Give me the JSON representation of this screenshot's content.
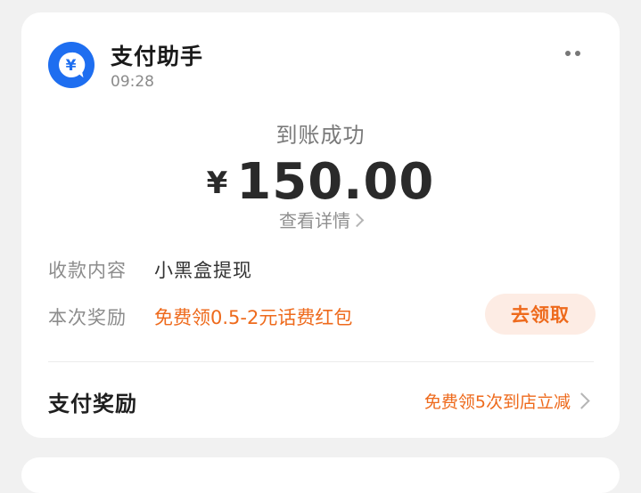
{
  "header": {
    "app_name": "支付助手",
    "time": "09:28",
    "icon_glyph": "¥"
  },
  "payment": {
    "status": "到账成功",
    "currency_symbol": "¥",
    "amount": "150.00",
    "detail_link": "查看详情"
  },
  "info_rows": [
    {
      "label": "收款内容",
      "value": "小黑盒提现"
    },
    {
      "label": "本次奖励",
      "value": "免费领0.5-2元话费红包"
    }
  ],
  "claim_button": {
    "label": "去领取"
  },
  "footer": {
    "title": "支付奖励",
    "link_text": "免费领5次到店立减"
  },
  "colors": {
    "brand_blue": "#1e6ef0",
    "accent_orange": "#ee6a1c",
    "claim_bg": "#fdece4",
    "background": "#f1f1f1"
  },
  "icons": {
    "avatar": "yen-payment-icon",
    "more": "more-dots-icon",
    "chevron": "chevron-right-icon"
  }
}
